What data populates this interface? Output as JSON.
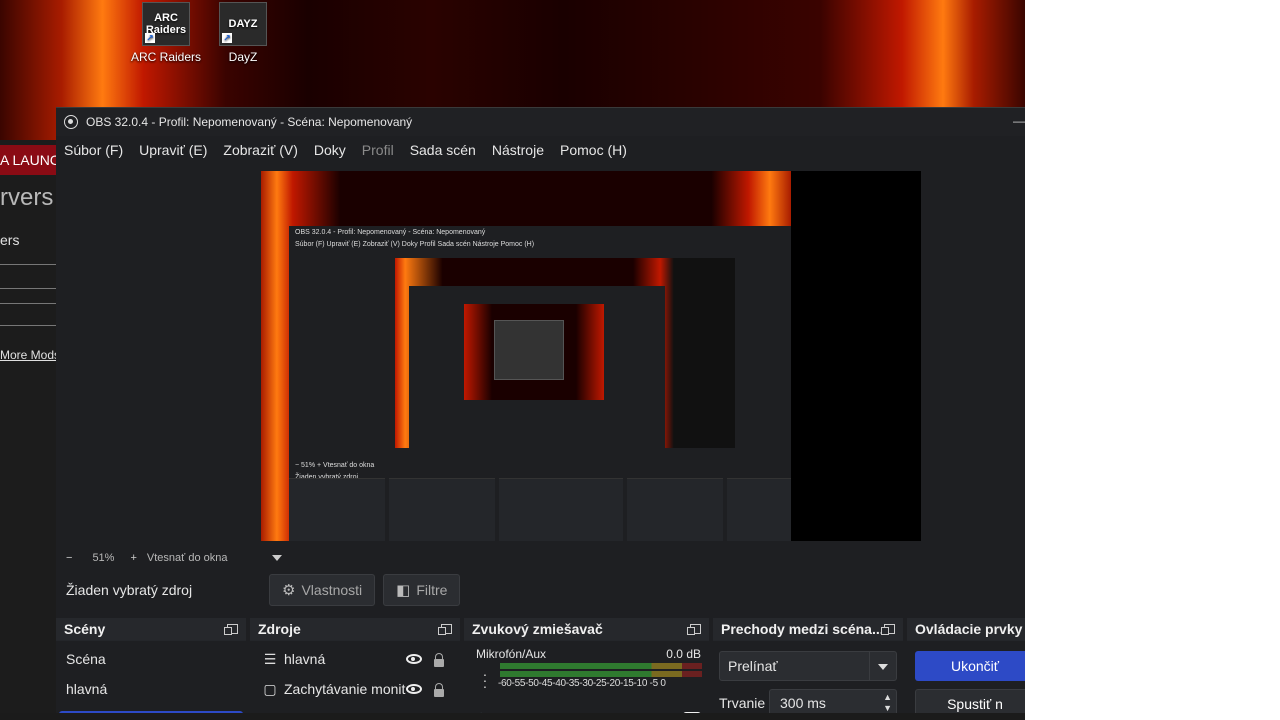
{
  "desktop": {
    "icons": [
      {
        "label": "ARC Raiders",
        "tile": "ARC Raiders"
      },
      {
        "label": "DayZ",
        "tile": "DAYZ"
      }
    ]
  },
  "launcher": {
    "band_text": "A LAUNC",
    "heading": "rvers",
    "sub": "ers",
    "link": "More Mods"
  },
  "obs": {
    "title": "OBS 32.0.4 - Profil: Nepomenovaný - Scéna: Nepomenovaný",
    "menu": [
      "Súbor (F)",
      "Upraviť (E)",
      "Zobraziť (V)",
      "Doky",
      "Profil",
      "Sada scén",
      "Nástroje",
      "Pomoc (H)"
    ],
    "zoom": {
      "minus": "−",
      "value": "51%",
      "plus": "+",
      "fit_label": "Vtesnať do okna"
    },
    "source_toolbar": {
      "no_source": "Žiaden vybratý zdroj",
      "properties": "Vlastnosti",
      "filters": "Filtre"
    },
    "docks": {
      "scenes": {
        "title": "Scény",
        "items": [
          "Scéna",
          "hlavná"
        ]
      },
      "sources": {
        "title": "Zdroje",
        "items": [
          "hlavná",
          "Zachytávanie monit"
        ]
      },
      "mixer": {
        "title": "Zvukový zmiešavač",
        "channel": "Mikrofón/Aux",
        "db": "0.0 dB",
        "ticks": "-60-55-50-45-40-35-30-25-20-15-10 -5  0",
        "volume_level": 0.96
      },
      "transitions": {
        "title": "Prechody medzi scéna...",
        "selected": "Prelínať",
        "duration_label": "Trvanie",
        "duration_value": "300 ms"
      },
      "controls": {
        "title": "Ovládacie prvky",
        "stop": "Ukončiť",
        "start": "Spustiť n"
      }
    },
    "preview_nested": {
      "title": "OBS 32.0.4 - Profil: Nepomenovaný - Scéna: Nepomenovaný",
      "menu": "Súbor (F)   Upraviť (E)   Zobraziť (V)   Doky   Profil   Sada scén   Nástroje   Pomoc (H)",
      "no_source": "Žiaden vybratý zdroj",
      "zoom": "−  51%  +  Vtesnať do okna"
    }
  }
}
